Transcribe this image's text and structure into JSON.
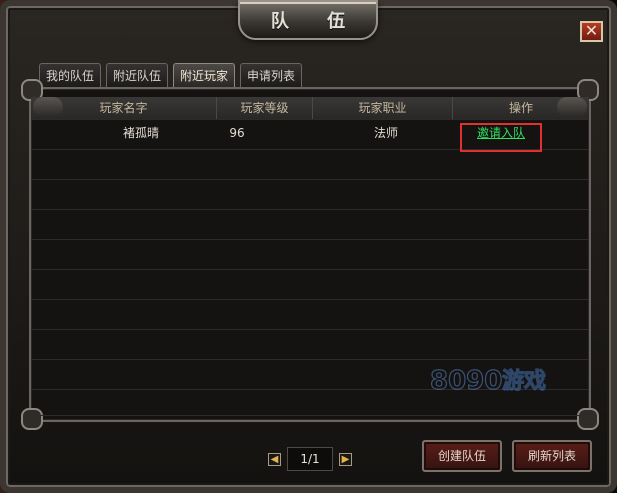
{
  "window": {
    "title": "队 伍",
    "close_icon": "close-icon"
  },
  "tabs": [
    {
      "label": "我的队伍",
      "active": false
    },
    {
      "label": "附近队伍",
      "active": false
    },
    {
      "label": "附近玩家",
      "active": true
    },
    {
      "label": "申请列表",
      "active": false
    }
  ],
  "table": {
    "headers": [
      "玩家名字",
      "玩家等级",
      "玩家职业",
      "操作"
    ],
    "rows": [
      {
        "name": "褚孤晴",
        "level": "96",
        "class": "法师",
        "action": "邀请入队"
      }
    ]
  },
  "pager": {
    "text": "1/1",
    "prev_icon": "arrow-left-icon",
    "next_icon": "arrow-right-icon"
  },
  "buttons": {
    "create_team": "创建队伍",
    "refresh_list": "刷新列表"
  },
  "watermark": {
    "text": "8090",
    "text2": "游戏"
  },
  "colors": {
    "accent": "#2fe060",
    "highlight_box": "#e0312e",
    "button_red": "#5a1d17"
  }
}
